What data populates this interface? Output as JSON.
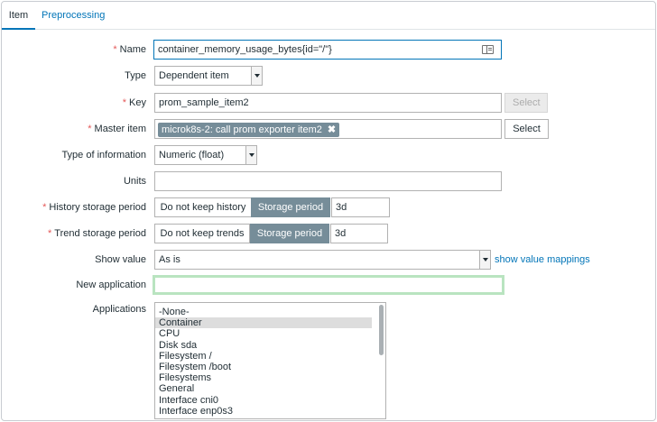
{
  "tabs": {
    "item": "Item",
    "preprocessing": "Preprocessing"
  },
  "form": {
    "required_mark": "*",
    "name": {
      "label": "Name",
      "value": "container_memory_usage_bytes{id=\"/\"}"
    },
    "type": {
      "label": "Type",
      "value": "Dependent item"
    },
    "key": {
      "label": "Key",
      "value": "prom_sample_item2",
      "select_label": "Select"
    },
    "master_item": {
      "label": "Master item",
      "value": "microk8s-2: call prom exporter item2",
      "remove": "✖",
      "select_label": "Select"
    },
    "type_of_information": {
      "label": "Type of information",
      "value": "Numeric (float)"
    },
    "units": {
      "label": "Units",
      "value": ""
    },
    "history": {
      "label": "History storage period",
      "option_off": "Do not keep history",
      "option_on": "Storage period",
      "value": "3d"
    },
    "trend": {
      "label": "Trend storage period",
      "option_off": "Do not keep trends",
      "option_on": "Storage period",
      "value": "3d"
    },
    "show_value": {
      "label": "Show value",
      "value": "As is",
      "mappings_link": "show value mappings"
    },
    "new_application": {
      "label": "New application",
      "value": ""
    },
    "applications": {
      "label": "Applications",
      "options": [
        "-None-",
        "Container",
        "CPU",
        "Disk sda",
        "Filesystem /",
        "Filesystem /boot",
        "Filesystems",
        "General",
        "Interface cni0",
        "Interface enp0s3"
      ],
      "selected": "Container"
    }
  }
}
